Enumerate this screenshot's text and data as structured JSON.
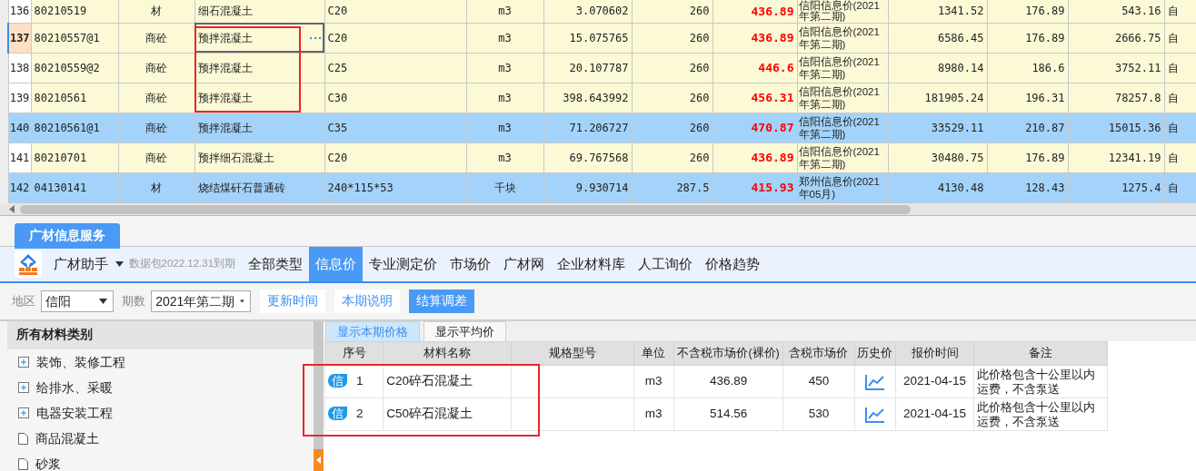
{
  "grid": {
    "rows": [
      {
        "cells": [
          "136",
          "80210519",
          "材",
          "细石混凝土",
          "C20",
          "m3",
          "3.070602",
          "260",
          "436.89",
          "信阳信息价(2021年第二期)",
          "1341.52",
          "176.89",
          "543.16",
          "自"
        ],
        "highlighted": false,
        "current": false,
        "framed": false
      },
      {
        "cells": [
          "137",
          "80210557@1",
          "商砼",
          "预拌混凝土",
          "C20",
          "m3",
          "15.075765",
          "260",
          "436.89",
          "信阳信息价(2021年第二期)",
          "6586.45",
          "176.89",
          "2666.75",
          "自"
        ],
        "highlighted": false,
        "current": true,
        "framed": true
      },
      {
        "cells": [
          "138",
          "80210559@2",
          "商砼",
          "预拌混凝土",
          "C25",
          "m3",
          "20.107787",
          "260",
          "446.6",
          "信阳信息价(2021年第二期)",
          "8980.14",
          "186.6",
          "3752.11",
          "自"
        ],
        "highlighted": false,
        "current": false,
        "framed": true
      },
      {
        "cells": [
          "139",
          "80210561",
          "商砼",
          "预拌混凝土",
          "C30",
          "m3",
          "398.643992",
          "260",
          "456.31",
          "信阳信息价(2021年第二期)",
          "181905.24",
          "196.31",
          "78257.8",
          "自"
        ],
        "highlighted": false,
        "current": false,
        "framed": true
      },
      {
        "cells": [
          "140",
          "80210561@1",
          "商砼",
          "预拌混凝土",
          "C35",
          "m3",
          "71.206727",
          "260",
          "470.87",
          "信阳信息价(2021年第二期)",
          "33529.11",
          "210.87",
          "15015.36",
          "自"
        ],
        "highlighted": true,
        "current": false,
        "framed": false
      },
      {
        "cells": [
          "141",
          "80210701",
          "商砼",
          "预拌细石混凝土",
          "C20",
          "m3",
          "69.767568",
          "260",
          "436.89",
          "信阳信息价(2021年第二期)",
          "30480.75",
          "176.89",
          "12341.19",
          "自"
        ],
        "highlighted": false,
        "current": false,
        "framed": false
      },
      {
        "cells": [
          "142",
          "04130141",
          "材",
          "烧结煤矸石普通砖",
          "240*115*53",
          "千块",
          "9.930714",
          "287.5",
          "415.93",
          "郑州信息价(2021年05月)",
          "4130.48",
          "128.43",
          "1275.4",
          "自"
        ],
        "highlighted": true,
        "current": false,
        "framed": false
      }
    ]
  },
  "service_tab": "广材信息服务",
  "toolbar": {
    "app_name": "广材助手",
    "license_note": "数据包2022.12.31到期",
    "nav": [
      {
        "label": "全部类型",
        "selected": false
      },
      {
        "label": "信息价",
        "selected": true
      },
      {
        "label": "专业测定价",
        "selected": false
      },
      {
        "label": "市场价",
        "selected": false
      },
      {
        "label": "广材网",
        "selected": false
      },
      {
        "label": "企业材料库",
        "selected": false
      },
      {
        "label": "人工询价",
        "selected": false
      },
      {
        "label": "价格趋势",
        "selected": false
      }
    ]
  },
  "filters": {
    "region_label": "地区",
    "region": "信阳",
    "period_label": "期数",
    "period": "2021年第二期",
    "buttons": [
      {
        "label": "更新时间",
        "primary": false
      },
      {
        "label": "本期说明",
        "primary": false
      },
      {
        "label": "结算调差",
        "primary": true
      }
    ]
  },
  "categories": {
    "title": "所有材料类别",
    "items": [
      {
        "label": "装饰、装修工程",
        "kind": "folder",
        "expanded": false
      },
      {
        "label": "给排水、采暖",
        "kind": "folder",
        "expanded": false
      },
      {
        "label": "电器安装工程",
        "kind": "folder",
        "expanded": false
      },
      {
        "label": "商品混凝土",
        "kind": "leaf"
      },
      {
        "label": "砂浆",
        "kind": "leaf"
      }
    ]
  },
  "price_view": {
    "tabs": [
      {
        "label": "显示本期价格",
        "selected": true
      },
      {
        "label": "显示平均价",
        "selected": false
      }
    ],
    "columns": [
      "序号",
      "材料名称",
      "规格型号",
      "单位",
      "不含税市场价(裸价)",
      "含税市场价",
      "历史价",
      "报价时间",
      "备注"
    ],
    "rows": [
      {
        "badge": "信",
        "number": "1",
        "name": "C20碎石混凝土",
        "unit": "m3",
        "price": "436.89",
        "tax_price": "450",
        "date": "2021-04-15",
        "note": "此价格包含十公里以内运费，不含泵送",
        "framed": true
      },
      {
        "badge": "信",
        "number": "2",
        "name": "C50碎石混凝土",
        "unit": "m3",
        "price": "514.56",
        "tax_price": "530",
        "date": "2021-04-15",
        "note": "此价格包含十公里以内运费，不含泵送",
        "framed": true
      }
    ]
  }
}
